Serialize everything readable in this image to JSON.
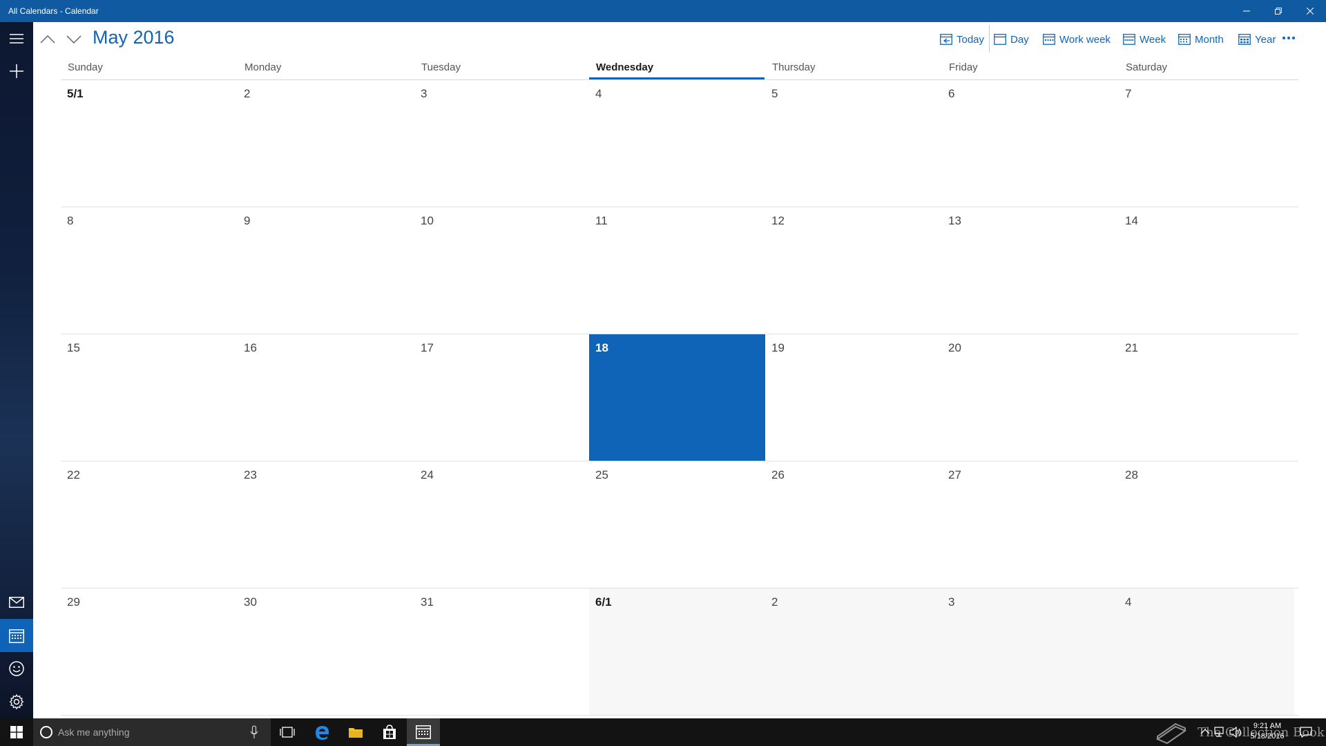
{
  "window": {
    "title": "All Calendars - Calendar"
  },
  "header": {
    "month_title": "May 2016",
    "views": {
      "today": "Today",
      "day": "Day",
      "work_week": "Work week",
      "week": "Week",
      "month": "Month",
      "year": "Year"
    }
  },
  "weekdays": [
    "Sunday",
    "Monday",
    "Tuesday",
    "Wednesday",
    "Thursday",
    "Friday",
    "Saturday"
  ],
  "today_column": 3,
  "weeks": [
    [
      "5/1",
      "2",
      "3",
      "4",
      "5",
      "6",
      "7"
    ],
    [
      "8",
      "9",
      "10",
      "11",
      "12",
      "13",
      "14"
    ],
    [
      "15",
      "16",
      "17",
      "18",
      "19",
      "20",
      "21"
    ],
    [
      "22",
      "23",
      "24",
      "25",
      "26",
      "27",
      "28"
    ],
    [
      "29",
      "30",
      "31",
      "6/1",
      "2",
      "3",
      "4"
    ]
  ],
  "today_cell": {
    "week": 2,
    "day": 3
  },
  "colors": {
    "accent": "#0f64b8",
    "titlebar": "#0f5aa0",
    "taskbar": "#131313"
  },
  "taskbar": {
    "search_placeholder": "Ask me anything",
    "clock_time": "9:21 AM",
    "clock_date": "5/18/2016",
    "watermark": "The Collection Book"
  }
}
